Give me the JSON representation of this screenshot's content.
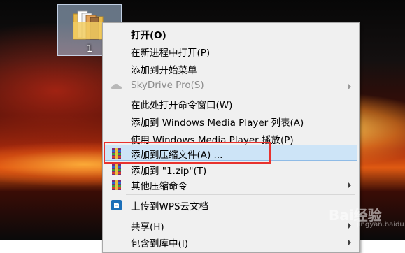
{
  "desktop": {
    "folder_label": "1"
  },
  "context_menu": {
    "items": [
      {
        "label": "打开(O)"
      },
      {
        "label": "在新进程中打开(P)"
      },
      {
        "label": "添加到开始菜单"
      },
      {
        "label": "SkyDrive Pro(S)"
      },
      {
        "label": "在此处打开命令窗口(W)"
      },
      {
        "label": "添加到 Windows Media Player 列表(A)"
      },
      {
        "label": "使用 Windows Media Player 播放(P)"
      },
      {
        "label": "添加到压缩文件(A) ..."
      },
      {
        "label": "添加到 \"1.zip\"(T)"
      },
      {
        "label": "其他压缩命令"
      },
      {
        "label": "上传到WPS云文档"
      },
      {
        "label": "共享(H)"
      },
      {
        "label": "包含到库中(I)"
      }
    ]
  },
  "colors": {
    "menu_background": "#f0f0f0",
    "hover_background": "#cde4f7",
    "highlight_box": "#e8322e"
  },
  "watermark": {
    "text": "Bai经验",
    "sub": "jingyan.baidu.com"
  }
}
